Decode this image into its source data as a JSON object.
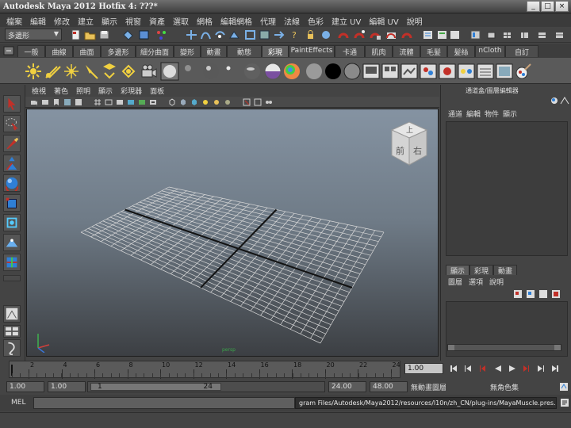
{
  "window": {
    "title": "Autodesk Maya 2012 Hotfix 4: ???*",
    "buttons": [
      "_",
      "□",
      "×"
    ]
  },
  "menubar": [
    "檔案",
    "編輯",
    "修改",
    "建立",
    "顯示",
    "視窗",
    "資產",
    "選取",
    "網格",
    "編輯網格",
    "代理",
    "法線",
    "色彩",
    "建立 UV",
    "編輯 UV",
    "說明"
  ],
  "status_line": {
    "mode_dropdown": "多邊形"
  },
  "shelf": {
    "tabs": [
      "一般",
      "曲線",
      "曲面",
      "多邊形",
      "細分曲面",
      "變形",
      "動畫",
      "動態",
      "彩現",
      "PaintEffects",
      "卡通",
      "肌肉",
      "流體",
      "毛髮",
      "髮絲",
      "nCloth",
      "自訂"
    ],
    "active_tab": "彩現"
  },
  "panel": {
    "menu": [
      "檢視",
      "著色",
      "照明",
      "顯示",
      "彩現器",
      "面板"
    ],
    "camera_label": "persp",
    "viewcube": {
      "top": "上",
      "front": "前",
      "right": "右"
    }
  },
  "channel_box": {
    "header": "通道盒/圖層編輯器",
    "menu": [
      "通道",
      "編輯",
      "物件",
      "顯示"
    ]
  },
  "layer_editor": {
    "tabs": [
      "顯示",
      "彩現",
      "動畫"
    ],
    "active_tab": "顯示",
    "menu": [
      "圖層",
      "選項",
      "說明"
    ]
  },
  "time_slider": {
    "ticks": [
      "2",
      "4",
      "6",
      "8",
      "10",
      "12",
      "14",
      "16",
      "18",
      "20",
      "22",
      "24"
    ],
    "current_frame": "1.00"
  },
  "range_slider": {
    "start_time": "1.00",
    "playback_start": "1.00",
    "range_start_label": "1",
    "range_end_label": "24",
    "playback_end": "24.00",
    "end_time": "48.00",
    "anim_layer": "無動畫圖層",
    "char_set": "無角色集"
  },
  "command_line": {
    "label": "MEL",
    "result": "gram Files/Autodesk/Maya2012/resources/l10n/zh_CN/plug-ins/MayaMuscle.pres.mel"
  },
  "colors": {
    "accent_red": "#c23028",
    "accent_blue": "#2f7fd6",
    "grid_line": "#d8d8d8",
    "axis_line": "#121212"
  }
}
